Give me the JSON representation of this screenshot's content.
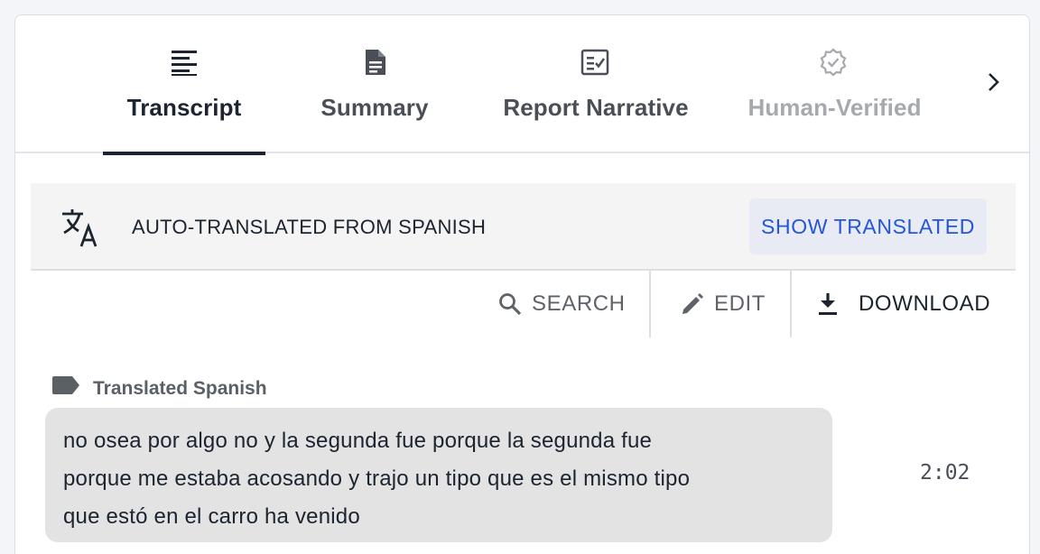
{
  "tabs": [
    {
      "label": "Transcript",
      "icon": "transcript-lines-icon",
      "state": "active"
    },
    {
      "label": "Summary",
      "icon": "document-icon",
      "state": "inactive"
    },
    {
      "label": "Report Narrative",
      "icon": "checklist-icon",
      "state": "inactive"
    },
    {
      "label": "Human-Verified",
      "icon": "verified-badge-icon",
      "state": "disabled"
    }
  ],
  "tab_next_icon": "chevron-right-icon",
  "banner": {
    "icon": "translate-icon",
    "text": "AUTO-TRANSLATED FROM SPANISH",
    "button": "SHOW TRANSLATED"
  },
  "toolbar": {
    "search": "SEARCH",
    "edit": "EDIT",
    "download": "DOWNLOAD"
  },
  "segment": {
    "speaker": "Translated Spanish",
    "lines": [
      "no osea por algo no y la segunda fue porque la segunda fue",
      "porque me estaba acosando y trajo un tipo que es el mismo tipo",
      "que estó en el carro ha venido"
    ],
    "timestamp": "2:02"
  },
  "colors": {
    "accent": "#2456d6",
    "active_underline": "#1b2231",
    "bubble": "#e3e3e3"
  }
}
